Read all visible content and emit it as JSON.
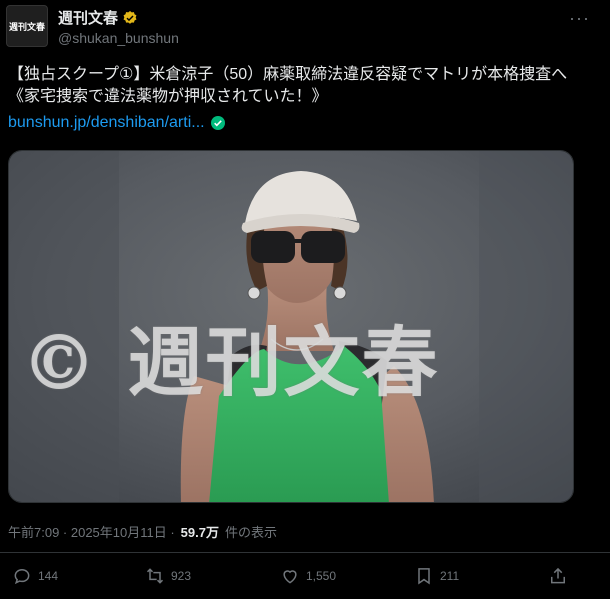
{
  "account": {
    "name": "週刊文春",
    "handle": "@shukan_bunshun",
    "avatar_text": "週刊文春"
  },
  "post": {
    "text": "【独占スクープ①】米倉涼子（50）麻薬取締法違反容疑でマトリが本格捜査へ《家宅捜索で違法薬物が押収されていた！》",
    "link": "bunshun.jp/denshiban/arti..."
  },
  "media": {
    "watermark": "© 週刊文春"
  },
  "meta": {
    "timestamp": "午前7:09 · 2025年10月11日 ·",
    "views": "59.7万",
    "views_suffix": "件の表示"
  },
  "actions": {
    "replies": "144",
    "reposts": "923",
    "likes": "1,550",
    "bookmarks": "211"
  },
  "colors": {
    "background": "#000000",
    "text": "#e7e9ea",
    "muted": "#71767b",
    "link": "#1d9bf0",
    "verified_gold": "#e2b719"
  }
}
